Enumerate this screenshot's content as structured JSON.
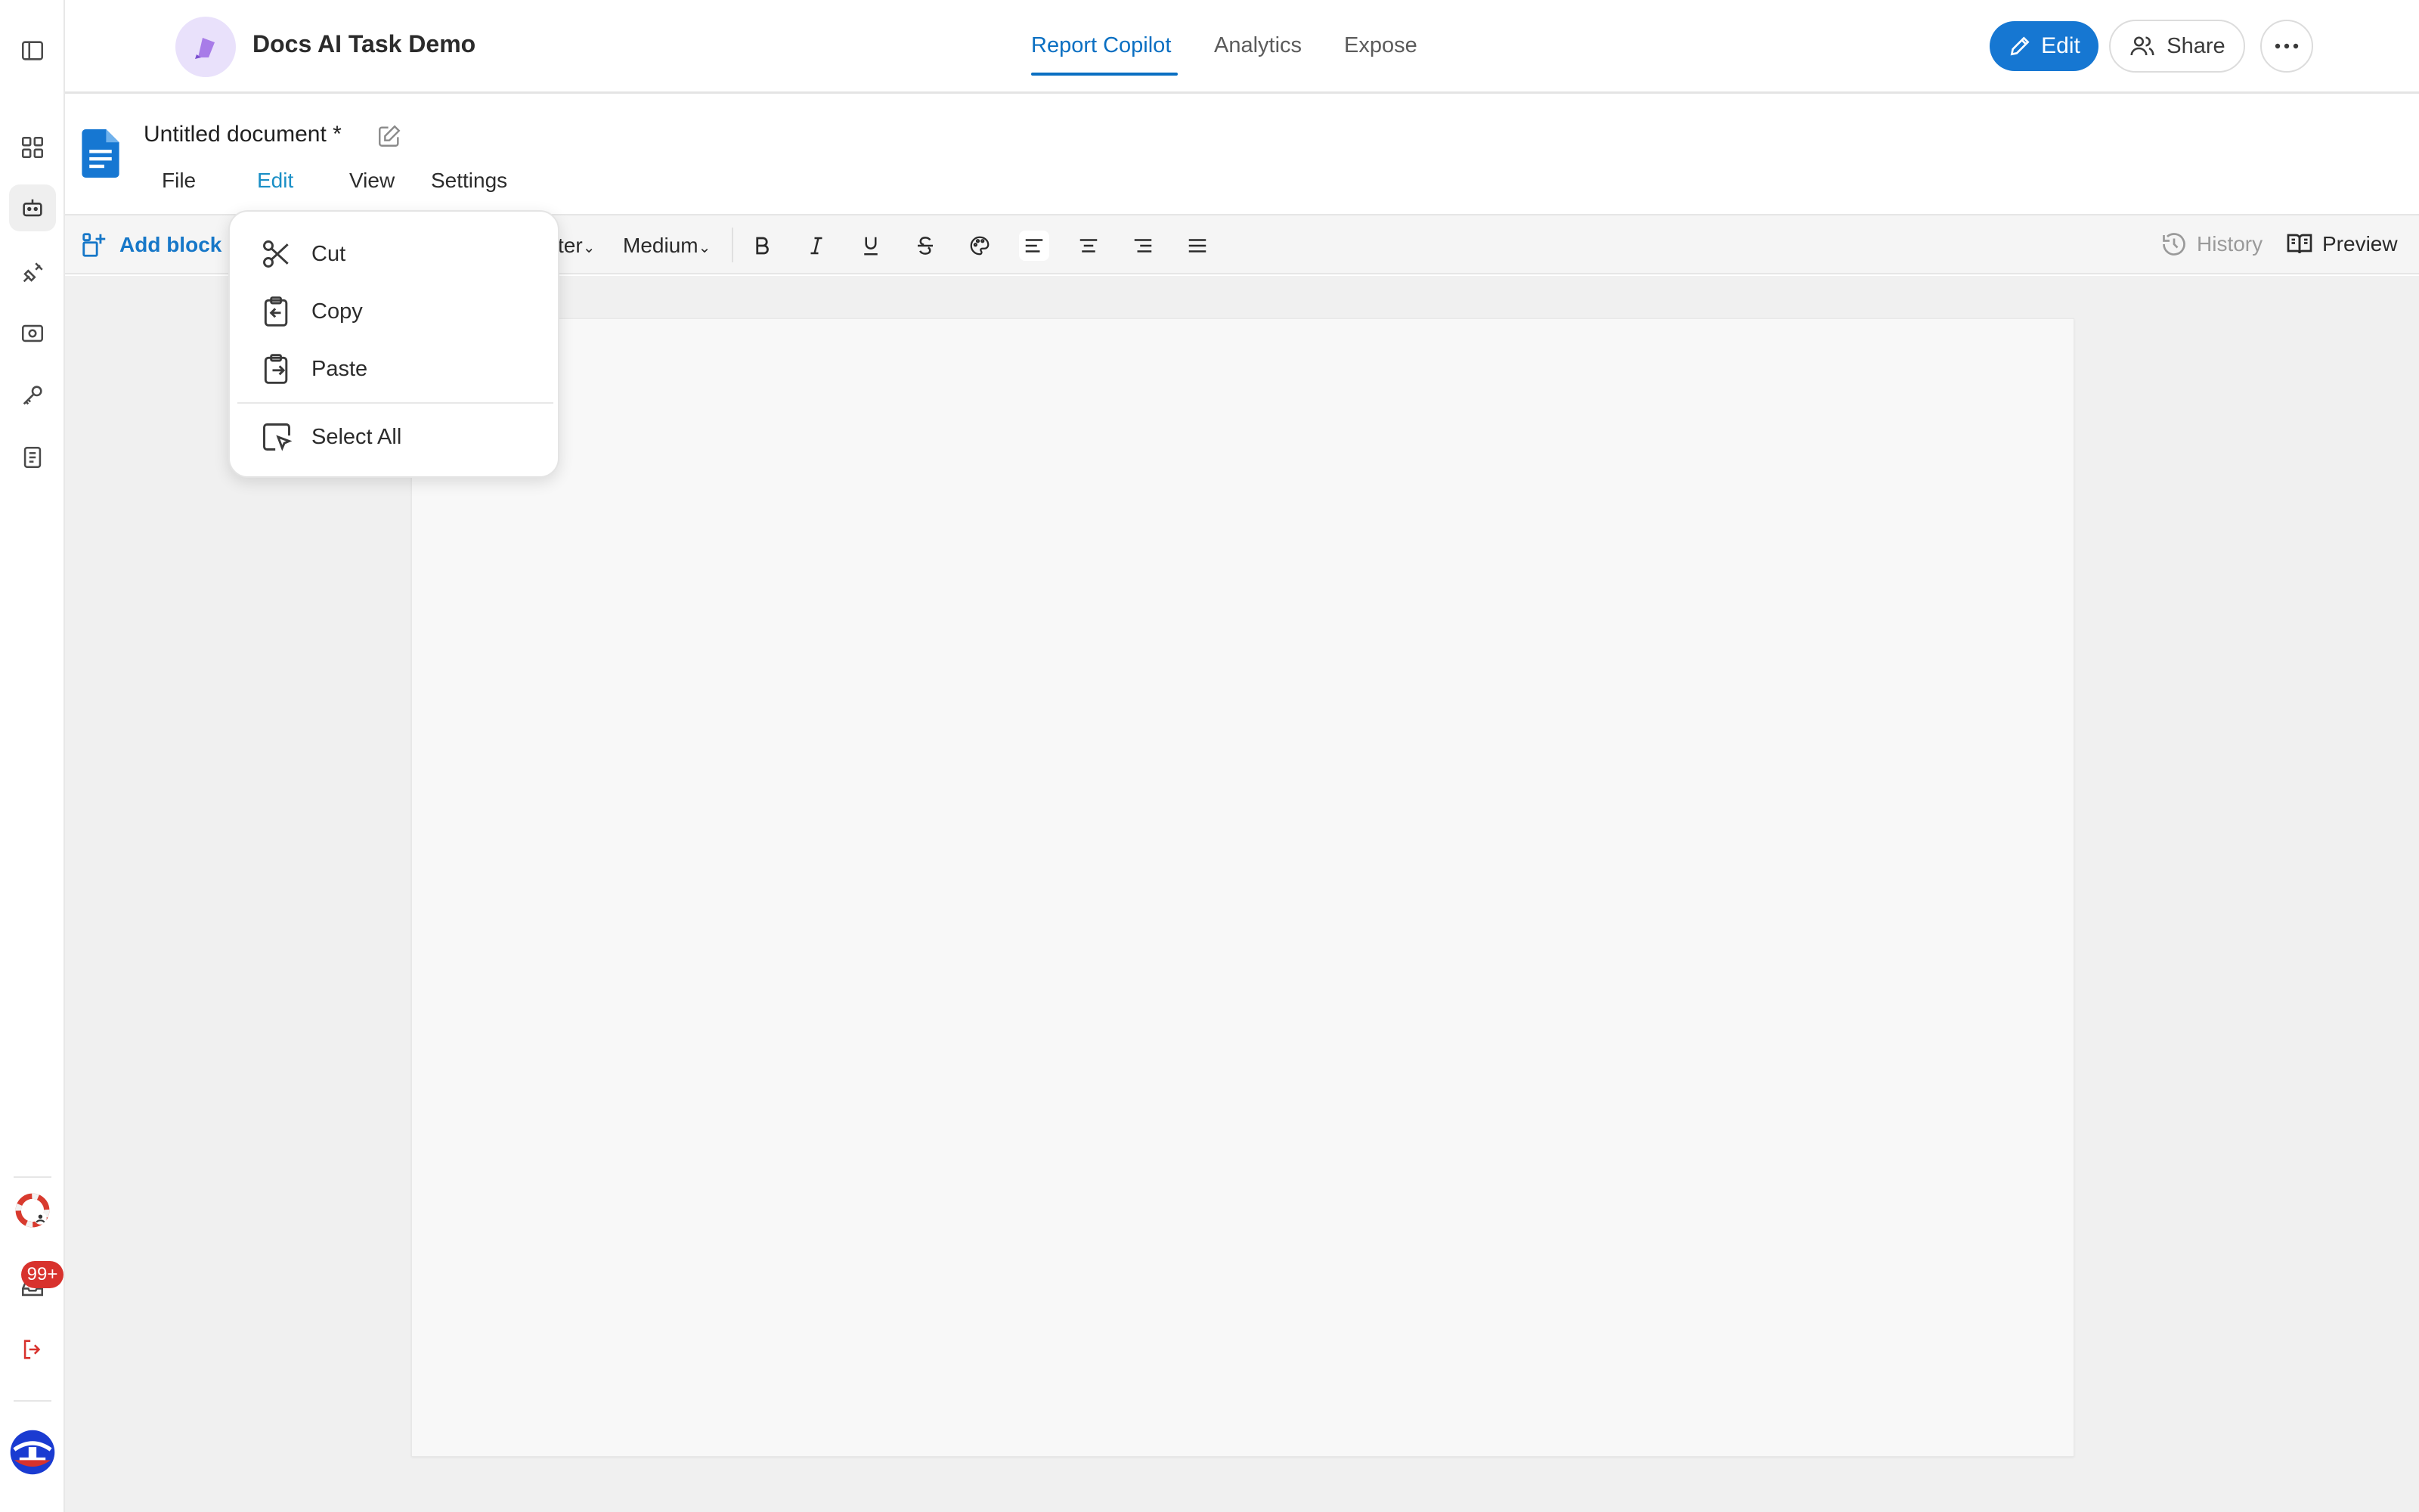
{
  "header": {
    "app_title": "Docs AI Task Demo",
    "tabs": [
      {
        "label": "Report Copilot",
        "active": true
      },
      {
        "label": "Analytics",
        "active": false
      },
      {
        "label": "Expose",
        "active": false
      }
    ],
    "edit_label": "Edit",
    "share_label": "Share"
  },
  "sidebar": {
    "notification_count": "99+",
    "items": [
      "panel-toggle",
      "dashboard",
      "bot",
      "plugin",
      "scan",
      "key",
      "notebook"
    ]
  },
  "document": {
    "title": "Untitled document *",
    "menu": [
      "File",
      "Edit",
      "View",
      "Settings"
    ],
    "active_menu": "Edit"
  },
  "toolbar": {
    "add_block_label": "Add block",
    "font_label": "ter",
    "weight_label": "Medium",
    "history_label": "History",
    "preview_label": "Preview"
  },
  "edit_menu": {
    "items": [
      {
        "label": "Cut",
        "icon": "scissors-icon"
      },
      {
        "label": "Copy",
        "icon": "copy-icon"
      },
      {
        "label": "Paste",
        "icon": "paste-icon"
      },
      {
        "label": "Select All",
        "icon": "select-all-icon"
      }
    ]
  },
  "colors": {
    "accent": "#1677d2",
    "active_tab": "#0a6fc2",
    "active_menu": "#1a8fc6",
    "badge": "#d8322d"
  }
}
